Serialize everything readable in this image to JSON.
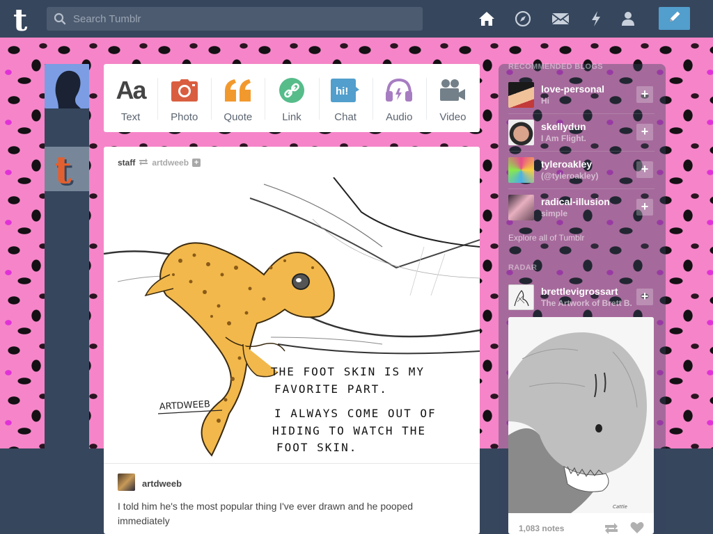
{
  "header": {
    "logo_letter": "t",
    "search_placeholder": "Search Tumblr",
    "nav_icons": [
      "home-icon",
      "explore-icon",
      "inbox-icon",
      "activity-icon",
      "account-icon"
    ],
    "compose_icon": "pencil-icon"
  },
  "colors": {
    "header_bg": "#36465d",
    "accent": "#529ecc",
    "background_pattern": "pink leopard"
  },
  "post_types": [
    {
      "label": "Text",
      "icon": "text-icon",
      "color": "#444444"
    },
    {
      "label": "Photo",
      "icon": "camera-icon",
      "color": "#d95e40"
    },
    {
      "label": "Quote",
      "icon": "quote-icon",
      "color": "#f2992e"
    },
    {
      "label": "Link",
      "icon": "link-icon",
      "color": "#56bc8a"
    },
    {
      "label": "Chat",
      "icon": "chat-icon",
      "color": "#529ecc"
    },
    {
      "label": "Audio",
      "icon": "headphones-icon",
      "color": "#a77dc2"
    },
    {
      "label": "Video",
      "icon": "video-camera-icon",
      "color": "#748089"
    }
  ],
  "post": {
    "author": "staff",
    "reblogged_from": "artdweeb",
    "art_caption_lines": [
      "THE FOOT SKIN IS MY",
      "FAVORITE PART.",
      "I ALWAYS COME OUT OF",
      "HIDING TO WATCH THE",
      "FOOT SKIN."
    ],
    "art_signature": "ARTDWEEB",
    "source_author": "artdweeb",
    "body": "I told him he's the most popular thing I've ever drawn and he pooped immediately"
  },
  "sidebar": {
    "recommended_title": "RECOMMENDED BLOGS",
    "recommended": [
      {
        "name": "love-personal",
        "desc": "Hi"
      },
      {
        "name": "skellydun",
        "desc": "I Am Flight."
      },
      {
        "name": "tyleroakley",
        "desc": "(@tyleroakley)"
      },
      {
        "name": "radical-illusion",
        "desc": "simple"
      }
    ],
    "explore_label": "Explore all of Tumblr",
    "radar_title": "RADAR",
    "radar_blog": {
      "name": "brettlevigrossart",
      "desc": "The Artwork of Brett B..."
    },
    "radar_notes": "1,083 notes"
  }
}
